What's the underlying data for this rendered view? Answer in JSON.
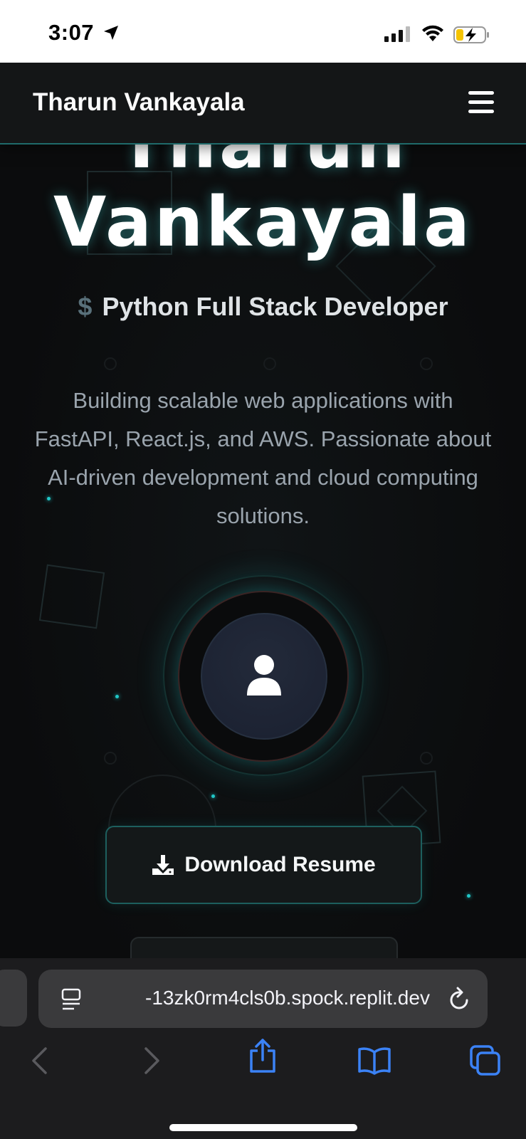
{
  "status_bar": {
    "time": "3:07"
  },
  "header": {
    "site_title": "Tharun Vankayala"
  },
  "hero": {
    "name_first": "Tharun",
    "name_last": "Vankayala",
    "role_prompt": "$",
    "role": "Python Full Stack Developer",
    "bio": "Building scalable web applications with FastAPI, React.js, and AWS. Passionate about AI-driven development and cloud computing solutions."
  },
  "actions": {
    "download_label": "Download Resume"
  },
  "browser": {
    "url": "-13zk0rm4cls0b.spock.replit.dev"
  },
  "colors": {
    "accent": "#20c7c7",
    "background": "#0d0e0f",
    "safari_bar": "#1c1c1e",
    "safari_blue": "#3b82f6"
  }
}
